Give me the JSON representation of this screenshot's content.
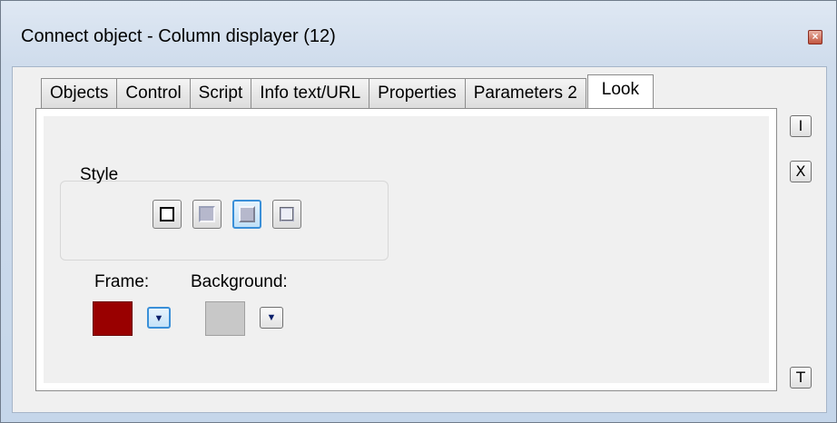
{
  "window": {
    "title": "Connect object - Column displayer (12)",
    "close_glyph": "×"
  },
  "tabs": [
    {
      "label": "Objects",
      "active": false
    },
    {
      "label": "Control",
      "active": false
    },
    {
      "label": "Script",
      "active": false
    },
    {
      "label": "Info text/URL",
      "active": false
    },
    {
      "label": "Properties",
      "active": false
    },
    {
      "label": "Parameters 2",
      "active": false
    },
    {
      "label": "Look",
      "active": true
    }
  ],
  "look": {
    "style_group_label": "Style",
    "style_options": [
      "flat-frame-icon",
      "sunken-frame-icon",
      "raised-frame-icon",
      "etched-frame-icon"
    ],
    "selected_style_index": 2,
    "frame_label": "Frame:",
    "frame_color": "#990000",
    "background_label": "Background:",
    "background_color": "#c8c8c8",
    "dropdown_glyph": "▼"
  },
  "side_buttons": [
    {
      "name": "insert-button",
      "glyph": "I"
    },
    {
      "name": "delete-button",
      "glyph": "X"
    },
    {
      "name": "text-button",
      "glyph": "T"
    }
  ]
}
